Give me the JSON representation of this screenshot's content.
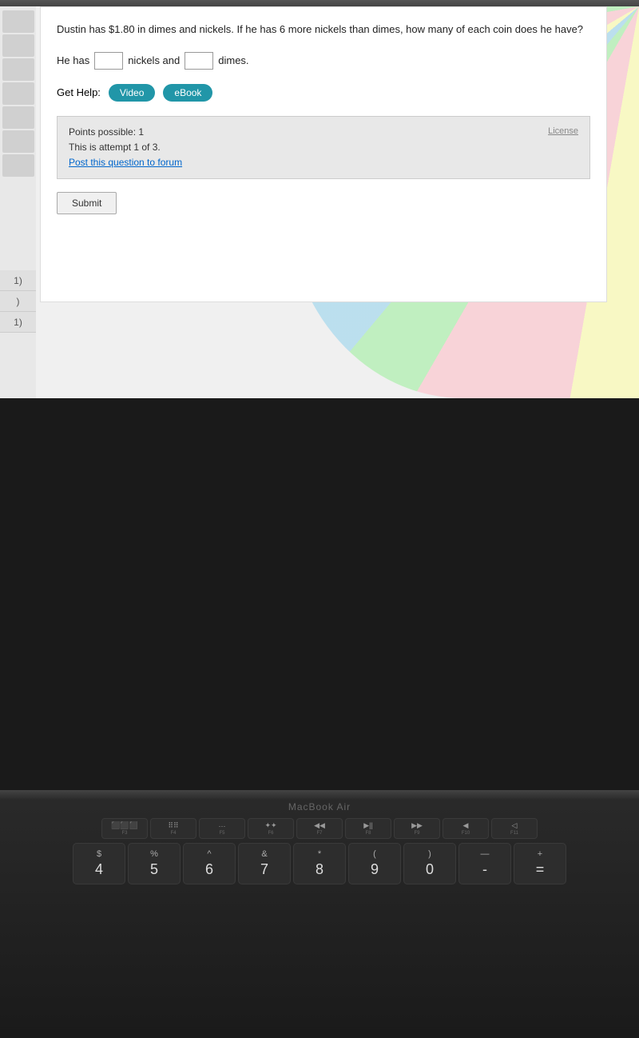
{
  "question": {
    "text": "Dustin has $1.80 in dimes and nickels. If he has 6 more nickels than dimes, how many of each coin does he have?",
    "answer_label_start": "He has",
    "answer_label_middle": "nickels and",
    "answer_label_end": "dimes.",
    "nickel_input_value": "",
    "dime_input_value": ""
  },
  "help": {
    "label": "Get Help:",
    "video_button": "Video",
    "ebook_button": "eBook"
  },
  "info": {
    "points": "Points possible: 1",
    "attempt": "This is attempt 1 of 3.",
    "post_link": "Post this question to forum",
    "license_link": "License"
  },
  "submit": {
    "label": "Submit"
  },
  "sidebar_numbers": [
    "1)",
    ")",
    "1)"
  ],
  "macbook": {
    "label": "MacBook Air"
  },
  "fn_keys": [
    {
      "icon": "⬛⬛⬛",
      "label": "F3"
    },
    {
      "icon": "⠿⠿⠿",
      "label": "F4"
    },
    {
      "icon": "···",
      "label": "F5"
    },
    {
      "icon": "✦✦✦",
      "label": "F6"
    },
    {
      "icon": "◀◀",
      "label": "F7"
    },
    {
      "icon": "▶||",
      "label": "F8"
    },
    {
      "icon": "▶▶",
      "label": "F9"
    },
    {
      "icon": "◀",
      "label": "F10"
    },
    {
      "icon": "◁",
      "label": "F11"
    }
  ],
  "num_keys": [
    {
      "top": "$",
      "bottom": "4"
    },
    {
      "top": "%",
      "bottom": "5"
    },
    {
      "top": "^",
      "bottom": "6"
    },
    {
      "top": "&",
      "bottom": "7"
    },
    {
      "top": "*",
      "bottom": "8"
    },
    {
      "top": "(",
      "bottom": "9"
    },
    {
      "top": ")",
      "bottom": "0"
    },
    {
      "top": "—",
      "bottom": "-"
    },
    {
      "top": "+",
      "bottom": "="
    }
  ]
}
